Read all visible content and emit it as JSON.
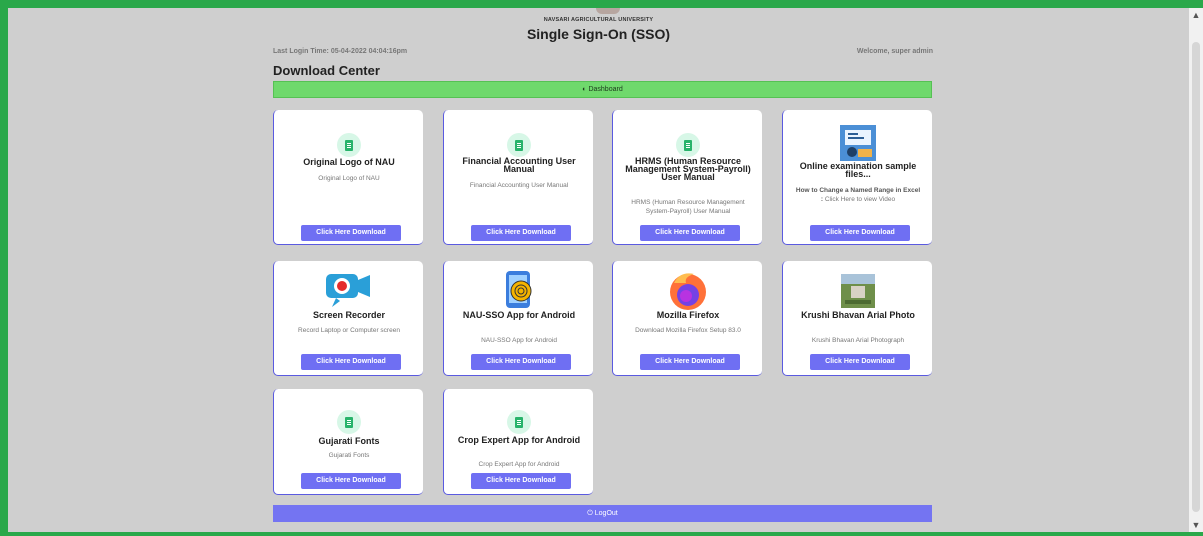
{
  "header": {
    "university": "NAVSARI AGRICULTURAL UNIVERSITY",
    "app_title": "Single Sign-On (SSO)",
    "last_login": "Last Login Time: 05-04-2022 04:04:16pm",
    "welcome": "Welcome, super admin"
  },
  "page": {
    "title": "Download Center",
    "dashboard_label": "Dashboard",
    "logout_label": "LogOut"
  },
  "cards": [
    {
      "title": "Original Logo of NAU",
      "desc": "Original Logo of NAU",
      "button": "Click Here Download",
      "icon": "document-icon"
    },
    {
      "title": "Financial Accounting User Manual",
      "desc": "Financial Accounting User Manual",
      "button": "Click Here Download",
      "icon": "document-icon"
    },
    {
      "title": "HRMS (Human Resource Management System-Payroll) User Manual",
      "desc": "HRMS (Human Resource Management System-Payroll) User Manual",
      "button": "Click Here Download",
      "icon": "document-icon"
    },
    {
      "title": "Online examination sample files...",
      "desc_bold": "How to Change a Named Range in Excel :",
      "desc": "Click Here to view Video",
      "button": "Click Here Download",
      "icon": "online-exam-icon"
    },
    {
      "title": "Screen Recorder",
      "desc": "Record Laptop or Computer screen",
      "button": "Click Here Download",
      "icon": "screen-recorder-icon"
    },
    {
      "title": "NAU-SSO App for Android",
      "desc": "NAU-SSO  App for Android",
      "button": "Click Here Download",
      "icon": "fingerprint-phone-icon"
    },
    {
      "title": "Mozilla Firefox",
      "desc": "Download Mozilla Firefox Setup 83.0",
      "button": "Click Here Download",
      "icon": "firefox-icon"
    },
    {
      "title": "Krushi Bhavan Arial Photo",
      "desc": "Krushi Bhavan Arial Photograph",
      "button": "Click Here Download",
      "icon": "building-photo-icon"
    },
    {
      "title": "Gujarati Fonts",
      "desc": "Gujarati Fonts",
      "button": "Click Here Download",
      "icon": "document-icon"
    },
    {
      "title": "Crop Expert App for Android",
      "desc": "Crop Expert App for Android",
      "button": "Click Here Download",
      "icon": "document-icon"
    }
  ],
  "colors": {
    "frame": "#2aa84a",
    "background": "#cfcfcf",
    "dashboard_bar": "#6fd96c",
    "button": "#6f6ff3",
    "logout_bar": "#7474f2"
  }
}
